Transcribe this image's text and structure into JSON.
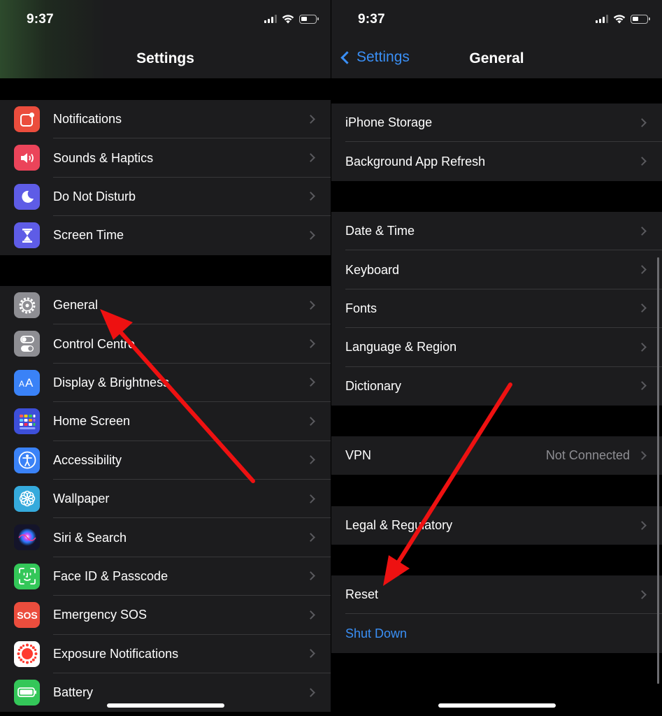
{
  "colors": {
    "background": "#000000",
    "cell": "#1c1c1e",
    "separator": "#38383a",
    "link_blue": "#3a8ff5",
    "secondary_text": "#8e8e93",
    "annotation_arrow": "#ee1111"
  },
  "left_screen": {
    "status_time": "9:37",
    "title": "Settings",
    "group1": [
      {
        "label": "Notifications",
        "icon": "notifications-icon",
        "icon_color": "#eb4d3d"
      },
      {
        "label": "Sounds & Haptics",
        "icon": "speaker-icon",
        "icon_color": "#eb445a"
      },
      {
        "label": "Do Not Disturb",
        "icon": "moon-icon",
        "icon_color": "#5e5ce6"
      },
      {
        "label": "Screen Time",
        "icon": "hourglass-icon",
        "icon_color": "#5e5ce6"
      }
    ],
    "group2": [
      {
        "label": "General",
        "icon": "gear-icon",
        "icon_color": "#8e8e93"
      },
      {
        "label": "Control Centre",
        "icon": "toggles-icon",
        "icon_color": "#8e8e93"
      },
      {
        "label": "Display & Brightness",
        "icon": "text-size-icon",
        "icon_color": "#3a82f7"
      },
      {
        "label": "Home Screen",
        "icon": "app-grid-icon",
        "icon_color": "#3d4fd9"
      },
      {
        "label": "Accessibility",
        "icon": "accessibility-icon",
        "icon_color": "#3a82f7"
      },
      {
        "label": "Wallpaper",
        "icon": "flower-icon",
        "icon_color": "#35aadc"
      },
      {
        "label": "Siri & Search",
        "icon": "siri-icon",
        "icon_color": "#1c1c30"
      },
      {
        "label": "Face ID & Passcode",
        "icon": "face-id-icon",
        "icon_color": "#34c759"
      },
      {
        "label": "Emergency SOS",
        "icon": "sos-icon",
        "icon_color": "#eb4d3d"
      },
      {
        "label": "Exposure Notifications",
        "icon": "exposure-icon",
        "icon_color": "#ffffff"
      },
      {
        "label": "Battery",
        "icon": "battery-icon",
        "icon_color": "#34c759"
      }
    ]
  },
  "right_screen": {
    "status_time": "9:37",
    "back_label": "Settings",
    "title": "General",
    "groups": [
      [
        {
          "label": "iPhone Storage"
        },
        {
          "label": "Background App Refresh"
        }
      ],
      [
        {
          "label": "Date & Time"
        },
        {
          "label": "Keyboard"
        },
        {
          "label": "Fonts"
        },
        {
          "label": "Language & Region"
        },
        {
          "label": "Dictionary"
        }
      ],
      [
        {
          "label": "VPN",
          "value": "Not Connected"
        }
      ],
      [
        {
          "label": "Legal & Regulatory"
        }
      ],
      [
        {
          "label": "Reset"
        },
        {
          "label": "Shut Down",
          "link": true
        }
      ]
    ]
  }
}
